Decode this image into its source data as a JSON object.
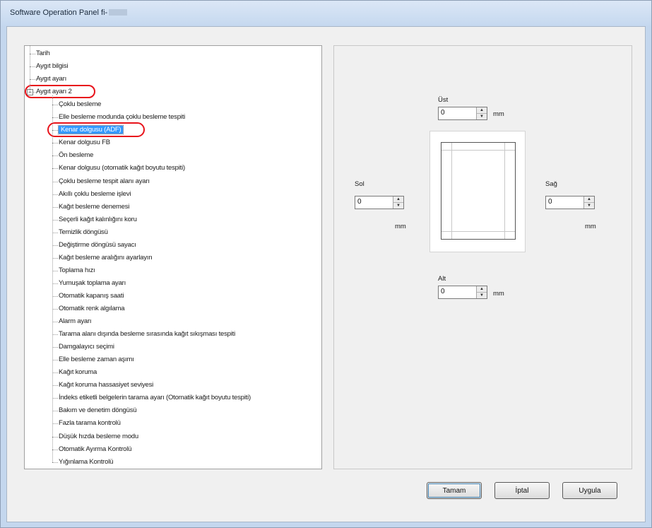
{
  "window": {
    "title": "Software Operation Panel fi-"
  },
  "tree": {
    "items": [
      {
        "label": "Tarih",
        "level": 0
      },
      {
        "label": "Aygıt bilgisi",
        "level": 0
      },
      {
        "label": "Aygıt ayarı",
        "level": 0
      },
      {
        "label": "Aygıt ayarı 2",
        "level": 0,
        "expanded": true
      },
      {
        "label": "Çoklu besleme",
        "level": 1
      },
      {
        "label": "Elle besleme modunda çoklu besleme tespiti",
        "level": 1
      },
      {
        "label": "Kenar dolgusu (ADF)",
        "level": 1,
        "selected": true
      },
      {
        "label": "Kenar dolgusu FB",
        "level": 1
      },
      {
        "label": "Ön besleme",
        "level": 1
      },
      {
        "label": "Kenar dolgusu (otomatik kağıt boyutu tespiti)",
        "level": 1
      },
      {
        "label": "Çoklu besleme tespit alanı ayarı",
        "level": 1
      },
      {
        "label": "Akıllı çoklu besleme işlevi",
        "level": 1
      },
      {
        "label": "Kağıt besleme denemesi",
        "level": 1
      },
      {
        "label": "Seçerli kağıt kalınlığını koru",
        "level": 1
      },
      {
        "label": "Temizlik döngüsü",
        "level": 1
      },
      {
        "label": "Değiştirme döngüsü sayacı",
        "level": 1
      },
      {
        "label": "Kağıt besleme aralığını ayarlayın",
        "level": 1
      },
      {
        "label": "Toplama hızı",
        "level": 1
      },
      {
        "label": "Yumuşak toplama ayarı",
        "level": 1
      },
      {
        "label": "Otomatik kapanış saati",
        "level": 1
      },
      {
        "label": "Otomatik renk algılama",
        "level": 1
      },
      {
        "label": "Alarm ayarı",
        "level": 1
      },
      {
        "label": "Tarama alanı dışında besleme sırasında kağıt sıkışması tespiti",
        "level": 1
      },
      {
        "label": "Damgalayıcı seçimi",
        "level": 1
      },
      {
        "label": "Elle besleme zaman aşımı",
        "level": 1
      },
      {
        "label": "Kağıt koruma",
        "level": 1
      },
      {
        "label": "Kağıt koruma hassasiyet seviyesi",
        "level": 1
      },
      {
        "label": "İndeks etiketli belgelerin tarama ayarı (Otomatik kağıt boyutu tespiti)",
        "level": 1
      },
      {
        "label": "Bakım ve denetim döngüsü",
        "level": 1
      },
      {
        "label": "Fazla tarama kontrolü",
        "level": 1
      },
      {
        "label": "Düşük hızda besleme modu",
        "level": 1
      },
      {
        "label": "Otomatik Ayırma Kontrolü",
        "level": 1
      },
      {
        "label": "Yığınlama Kontrolü",
        "level": 1
      }
    ]
  },
  "margins": {
    "top": {
      "label": "Üst",
      "value": "0",
      "unit": "mm"
    },
    "left": {
      "label": "Sol",
      "value": "0",
      "unit": "mm"
    },
    "right": {
      "label": "Sağ",
      "value": "0",
      "unit": "mm"
    },
    "bottom": {
      "label": "Alt",
      "value": "0",
      "unit": "mm"
    }
  },
  "buttons": {
    "ok": "Tamam",
    "cancel": "İptal",
    "apply": "Uygula"
  },
  "colors": {
    "selection": "#3399ff",
    "highlight": "#e8131b"
  }
}
